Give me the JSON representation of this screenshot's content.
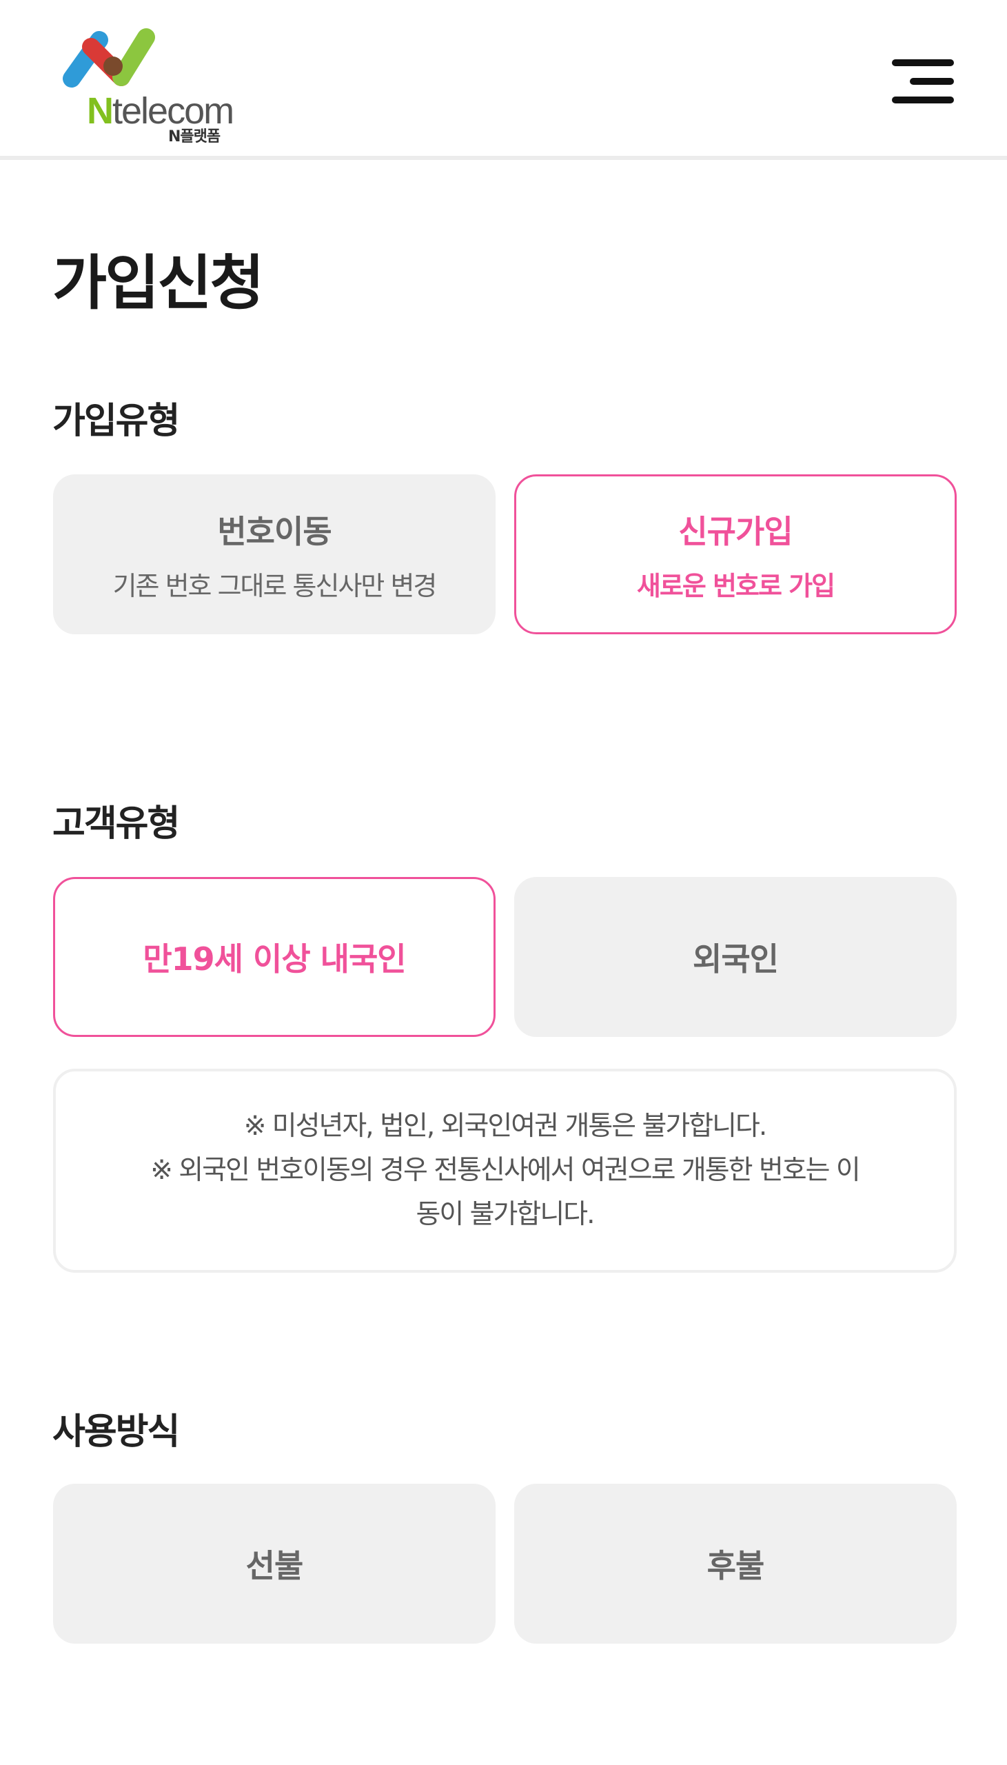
{
  "header": {
    "logo_letter": "N",
    "logo_rest": "telecom",
    "logo_sub": "N플랫폼",
    "menu_icon": "hamburger-menu-icon",
    "logo_colors": [
      "#2f9bd8",
      "#d93a36",
      "#8cc63f",
      "#7a4a2c"
    ]
  },
  "page": {
    "title": "가입신청"
  },
  "sections": {
    "join_type": {
      "title": "가입유형",
      "options": [
        {
          "main": "번호이동",
          "sub": "기존 번호 그대로 통신사만 변경",
          "selected": false
        },
        {
          "main": "신규가입",
          "sub": "새로운 번호로 가입",
          "selected": true
        }
      ]
    },
    "customer_type": {
      "title": "고객유형",
      "options": [
        {
          "main": "만19세 이상 내국인",
          "selected": true
        },
        {
          "main": "외국인",
          "selected": false
        }
      ],
      "notice": {
        "line1": "※ 미성년자, 법인, 외국인여권 개통은 불가합니다.",
        "line2": "※ 외국인 번호이동의 경우 전통신사에서 여권으로 개통한 번호는 이",
        "line3": "동이 불가합니다."
      }
    },
    "usage_type": {
      "title": "사용방식",
      "options": [
        {
          "main": "선불",
          "selected": false
        },
        {
          "main": "후불",
          "selected": false
        }
      ]
    }
  },
  "colors": {
    "accent": "#f0519a",
    "option_bg": "#f0f0f0",
    "brand_green": "#82c01f"
  }
}
